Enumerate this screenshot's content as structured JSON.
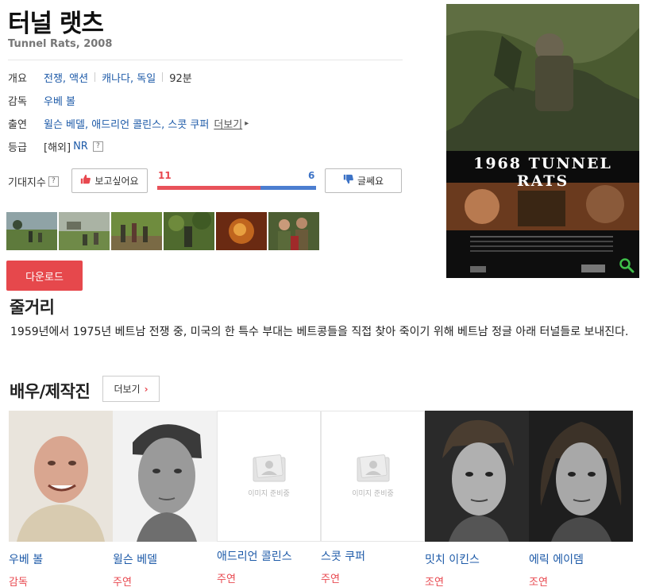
{
  "movie": {
    "title": "터널 랫츠",
    "subtitle": "Tunnel Rats, 2008"
  },
  "info": {
    "overview_label": "개요",
    "genres": "전쟁, 액션",
    "countries": "캐나다, 독일",
    "runtime": "92분",
    "director_label": "감독",
    "director": "우베 볼",
    "cast_label": "출연",
    "cast": "윌슨 베델, 애드리언 콜린스, 스콧 쿠퍼",
    "more_label": "더보기",
    "rating_label": "등급",
    "rating_region": "[해외]",
    "rating_value": "NR",
    "help_mark": "?"
  },
  "expectation": {
    "label": "기대지수",
    "want_label": "보고싶어요",
    "meh_label": "글쎄요",
    "want_count": "11",
    "meh_count": "6",
    "want_ratio": 0.65
  },
  "download_label": "다운로드",
  "poster": {
    "title_text": "1968 TUNNEL RATS"
  },
  "synopsis": {
    "heading": "줄거리",
    "text": "1959년에서 1975년 베트남 전쟁 중, 미국의 한 특수 부대는 베트콩들을 직접 찾아 죽이기 위해 베트남 정글 아래 터널들로 보내진다."
  },
  "cast_section": {
    "heading": "배우/제작진",
    "more_label": "더보기",
    "no_image_text": "이미지 준비중",
    "members": [
      {
        "name": "우베 볼",
        "role": "감독"
      },
      {
        "name": "윌슨 베델",
        "role": "주연"
      },
      {
        "name": "애드리언 콜린스",
        "role": "주연"
      },
      {
        "name": "스콧 쿠퍼",
        "role": "주연"
      },
      {
        "name": "밋치 이킨스",
        "role": "조연"
      },
      {
        "name": "에릭 에이뎀",
        "role": "조연"
      }
    ]
  },
  "colors": {
    "link": "#1d5aa8",
    "accent_red": "#e8484f",
    "accent_blue": "#3d73c6",
    "download_bg": "#e6484c"
  }
}
